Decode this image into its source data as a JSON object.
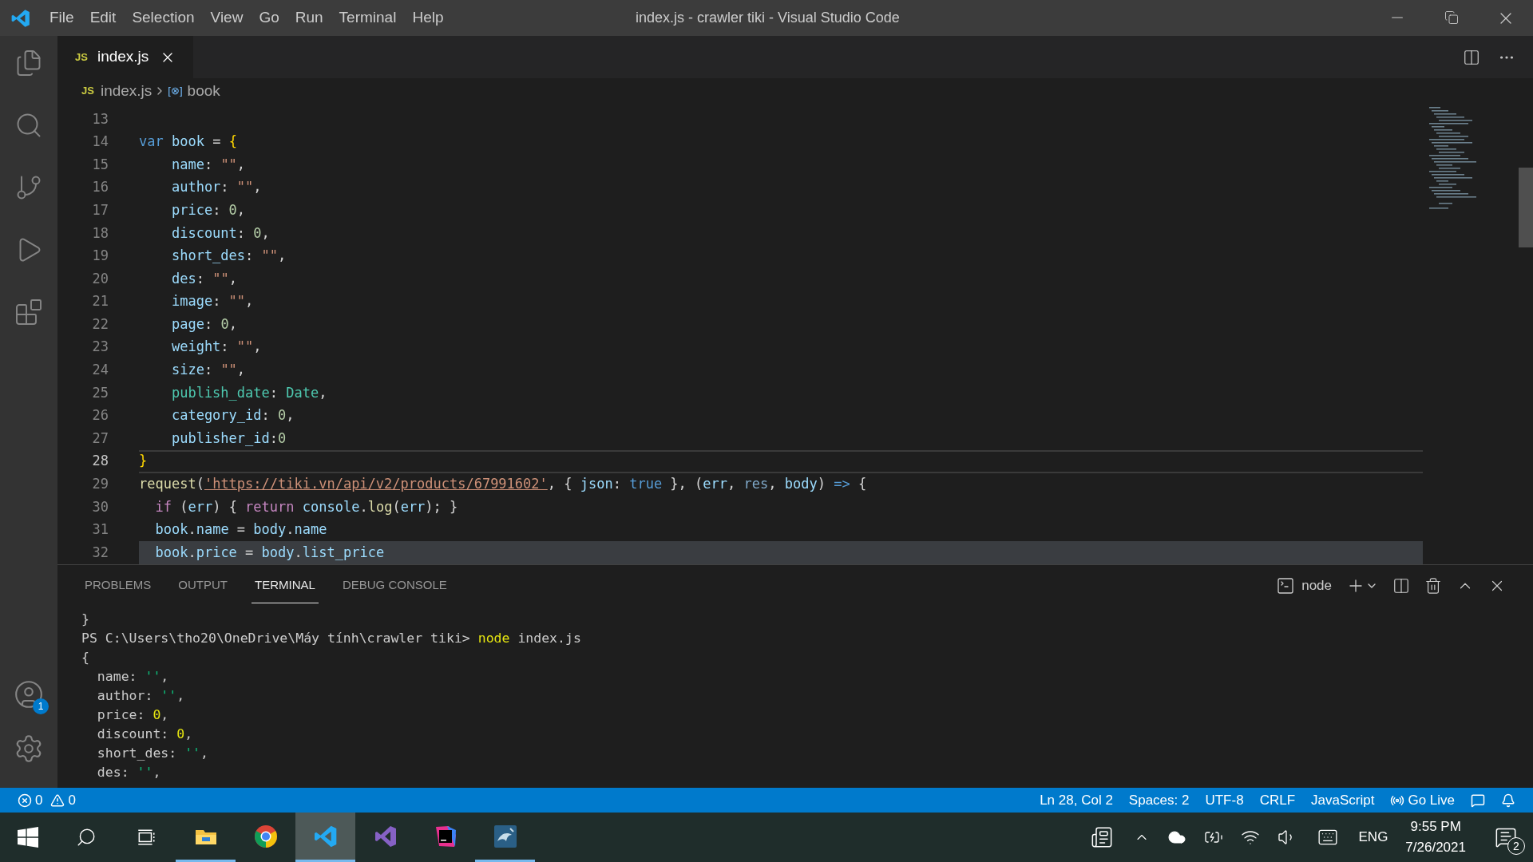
{
  "window": {
    "title": "index.js - crawler tiki - Visual Studio Code"
  },
  "menu": [
    "File",
    "Edit",
    "Selection",
    "View",
    "Go",
    "Run",
    "Terminal",
    "Help"
  ],
  "activity_bar": [
    {
      "kind": "files"
    },
    {
      "kind": "search"
    },
    {
      "kind": "source-control"
    },
    {
      "kind": "run"
    },
    {
      "kind": "extensions"
    }
  ],
  "activity_bottom": [
    {
      "kind": "account",
      "badge": "1"
    },
    {
      "kind": "settings"
    }
  ],
  "tabs": [
    {
      "icon": "JS",
      "label": "index.js",
      "selected": true
    }
  ],
  "breadcrumbs": [
    {
      "icon": "JS",
      "label": "index.js"
    },
    {
      "icon": "[⊗]",
      "label": "book"
    }
  ],
  "editor": {
    "lines": [
      {
        "number": "13",
        "current": false,
        "highlighted": false
      },
      {
        "number": "14",
        "current": false,
        "highlighted": false,
        "tokens": [
          {
            "text": "var",
            "kind": "keyword"
          },
          {
            "text": " book",
            "kind": "variable"
          },
          {
            "text": " = ",
            "kind": "punct"
          },
          {
            "text": "{",
            "kind": "bracket"
          }
        ]
      },
      {
        "number": "15",
        "current": false,
        "highlighted": false,
        "tokens": [
          {
            "text": "    name",
            "kind": "variable"
          },
          {
            "text": ": ",
            "kind": "punct"
          },
          {
            "text": "\"\"",
            "kind": "string"
          },
          {
            "text": ",",
            "kind": "punct"
          }
        ]
      },
      {
        "number": "16",
        "current": false,
        "highlighted": false,
        "tokens": [
          {
            "text": "    author",
            "kind": "variable"
          },
          {
            "text": ": ",
            "kind": "punct"
          },
          {
            "text": "\"\"",
            "kind": "string"
          },
          {
            "text": ",",
            "kind": "punct"
          }
        ]
      },
      {
        "number": "17",
        "current": false,
        "highlighted": false,
        "tokens": [
          {
            "text": "    price",
            "kind": "variable"
          },
          {
            "text": ": ",
            "kind": "punct"
          },
          {
            "text": "0",
            "kind": "number"
          },
          {
            "text": ",",
            "kind": "punct"
          }
        ]
      },
      {
        "number": "18",
        "current": false,
        "highlighted": false,
        "tokens": [
          {
            "text": "    discount",
            "kind": "variable"
          },
          {
            "text": ": ",
            "kind": "punct"
          },
          {
            "text": "0",
            "kind": "number"
          },
          {
            "text": ",",
            "kind": "punct"
          }
        ]
      },
      {
        "number": "19",
        "current": false,
        "highlighted": false,
        "tokens": [
          {
            "text": "    short_des",
            "kind": "variable"
          },
          {
            "text": ": ",
            "kind": "punct"
          },
          {
            "text": "\"\"",
            "kind": "string"
          },
          {
            "text": ",",
            "kind": "punct"
          }
        ]
      },
      {
        "number": "20",
        "current": false,
        "highlighted": false,
        "tokens": [
          {
            "text": "    des",
            "kind": "variable"
          },
          {
            "text": ": ",
            "kind": "punct"
          },
          {
            "text": "\"\"",
            "kind": "string"
          },
          {
            "text": ",",
            "kind": "punct"
          }
        ]
      },
      {
        "number": "21",
        "current": false,
        "highlighted": false,
        "tokens": [
          {
            "text": "    image",
            "kind": "variable"
          },
          {
            "text": ": ",
            "kind": "punct"
          },
          {
            "text": "\"\"",
            "kind": "string"
          },
          {
            "text": ",",
            "kind": "punct"
          }
        ]
      },
      {
        "number": "22",
        "current": false,
        "highlighted": false,
        "tokens": [
          {
            "text": "    page",
            "kind": "variable"
          },
          {
            "text": ": ",
            "kind": "punct"
          },
          {
            "text": "0",
            "kind": "number"
          },
          {
            "text": ",",
            "kind": "punct"
          }
        ]
      },
      {
        "number": "23",
        "current": false,
        "highlighted": false,
        "tokens": [
          {
            "text": "    weight",
            "kind": "variable"
          },
          {
            "text": ": ",
            "kind": "punct"
          },
          {
            "text": "\"\"",
            "kind": "string"
          },
          {
            "text": ",",
            "kind": "punct"
          }
        ]
      },
      {
        "number": "24",
        "current": false,
        "highlighted": false,
        "tokens": [
          {
            "text": "    size",
            "kind": "variable"
          },
          {
            "text": ": ",
            "kind": "punct"
          },
          {
            "text": "\"\"",
            "kind": "string"
          },
          {
            "text": ",",
            "kind": "punct"
          }
        ]
      },
      {
        "number": "25",
        "current": false,
        "highlighted": false,
        "tokens": [
          {
            "text": "    publish_date",
            "kind": "type"
          },
          {
            "text": ": ",
            "kind": "punct"
          },
          {
            "text": "Date",
            "kind": "type"
          },
          {
            "text": ",",
            "kind": "punct"
          }
        ]
      },
      {
        "number": "26",
        "current": false,
        "highlighted": false,
        "tokens": [
          {
            "text": "    category_id",
            "kind": "variable"
          },
          {
            "text": ": ",
            "kind": "punct"
          },
          {
            "text": "0",
            "kind": "number"
          },
          {
            "text": ",",
            "kind": "punct"
          }
        ]
      },
      {
        "number": "27",
        "current": false,
        "highlighted": false,
        "tokens": [
          {
            "text": "    publisher_id",
            "kind": "variable"
          },
          {
            "text": ":",
            "kind": "punct"
          },
          {
            "text": "0",
            "kind": "number"
          }
        ]
      },
      {
        "number": "28",
        "current": true,
        "highlighted": false,
        "tokens": [
          {
            "text": "}",
            "kind": "bracket"
          }
        ]
      },
      {
        "number": "29",
        "current": false,
        "highlighted": false,
        "tokens": [
          {
            "text": "request",
            "kind": "function"
          },
          {
            "text": "(",
            "kind": "punct"
          },
          {
            "text": "'https://tiki.vn/api/v2/products/67991602'",
            "kind": "link"
          },
          {
            "text": ", { ",
            "kind": "punct"
          },
          {
            "text": "json",
            "kind": "variable"
          },
          {
            "text": ": ",
            "kind": "punct"
          },
          {
            "text": "true",
            "kind": "keyword"
          },
          {
            "text": " }, (",
            "kind": "punct"
          },
          {
            "text": "err",
            "kind": "variable"
          },
          {
            "text": ", ",
            "kind": "punct"
          },
          {
            "text": "res",
            "kind": "param"
          },
          {
            "text": ", ",
            "kind": "punct"
          },
          {
            "text": "body",
            "kind": "variable"
          },
          {
            "text": ") ",
            "kind": "punct"
          },
          {
            "text": "=>",
            "kind": "keyword"
          },
          {
            "text": " {",
            "kind": "punct"
          }
        ]
      },
      {
        "number": "30",
        "current": false,
        "highlighted": false,
        "tokens": [
          {
            "text": "  if",
            "kind": "control"
          },
          {
            "text": " (",
            "kind": "punct"
          },
          {
            "text": "err",
            "kind": "variable"
          },
          {
            "text": ") { ",
            "kind": "punct"
          },
          {
            "text": "return",
            "kind": "control"
          },
          {
            "text": " console",
            "kind": "variable"
          },
          {
            "text": ".",
            "kind": "punct"
          },
          {
            "text": "log",
            "kind": "function"
          },
          {
            "text": "(",
            "kind": "punct"
          },
          {
            "text": "err",
            "kind": "variable"
          },
          {
            "text": "); }",
            "kind": "punct"
          }
        ]
      },
      {
        "number": "31",
        "current": false,
        "highlighted": false,
        "tokens": [
          {
            "text": "  book",
            "kind": "variable"
          },
          {
            "text": ".",
            "kind": "punct"
          },
          {
            "text": "name",
            "kind": "variable"
          },
          {
            "text": " = ",
            "kind": "punct"
          },
          {
            "text": "body",
            "kind": "variable"
          },
          {
            "text": ".",
            "kind": "punct"
          },
          {
            "text": "name",
            "kind": "variable"
          }
        ]
      },
      {
        "number": "32",
        "current": false,
        "highlighted": true,
        "tokens": [
          {
            "text": "  book",
            "kind": "variable"
          },
          {
            "text": ".",
            "kind": "punct"
          },
          {
            "text": "price",
            "kind": "variable"
          },
          {
            "text": " = ",
            "kind": "punct"
          },
          {
            "text": "body",
            "kind": "variable"
          },
          {
            "text": ".",
            "kind": "punct"
          },
          {
            "text": "list_price",
            "kind": "variable"
          }
        ]
      }
    ]
  },
  "panel": {
    "tabs": [
      {
        "label": "PROBLEMS",
        "selected": false
      },
      {
        "label": "OUTPUT",
        "selected": false
      },
      {
        "label": "TERMINAL",
        "selected": true
      },
      {
        "label": "DEBUG CONSOLE",
        "selected": false
      }
    ],
    "terminal_name": "node",
    "terminal_lines": [
      [
        {
          "text": "}",
          "kind": "plain"
        }
      ],
      [
        {
          "text": "PS C:\\Users\\tho20\\OneDrive\\Máy tính\\crawler tiki> ",
          "kind": "plain"
        },
        {
          "text": "node",
          "kind": "command"
        },
        {
          "text": " index.js",
          "kind": "plain"
        }
      ],
      [
        {
          "text": "{",
          "kind": "plain"
        }
      ],
      [
        {
          "text": "  name: ",
          "kind": "plain"
        },
        {
          "text": "''",
          "kind": "string"
        },
        {
          "text": ",",
          "kind": "plain"
        }
      ],
      [
        {
          "text": "  author: ",
          "kind": "plain"
        },
        {
          "text": "''",
          "kind": "string"
        },
        {
          "text": ",",
          "kind": "plain"
        }
      ],
      [
        {
          "text": "  price: ",
          "kind": "plain"
        },
        {
          "text": "0",
          "kind": "number"
        },
        {
          "text": ",",
          "kind": "plain"
        }
      ],
      [
        {
          "text": "  discount: ",
          "kind": "plain"
        },
        {
          "text": "0",
          "kind": "number"
        },
        {
          "text": ",",
          "kind": "plain"
        }
      ],
      [
        {
          "text": "  short_des: ",
          "kind": "plain"
        },
        {
          "text": "''",
          "kind": "string"
        },
        {
          "text": ",",
          "kind": "plain"
        }
      ],
      [
        {
          "text": "  des: ",
          "kind": "plain"
        },
        {
          "text": "''",
          "kind": "string"
        },
        {
          "text": ",",
          "kind": "plain"
        }
      ]
    ]
  },
  "status_bar": {
    "errors": "0",
    "warnings": "0",
    "items": [
      {
        "kind": "text",
        "label": "Ln 28, Col 2"
      },
      {
        "kind": "text",
        "label": "Spaces: 2"
      },
      {
        "kind": "text",
        "label": "UTF-8"
      },
      {
        "kind": "text",
        "label": "CRLF"
      },
      {
        "kind": "text",
        "label": "JavaScript"
      },
      {
        "kind": "live",
        "label": "Go Live"
      },
      {
        "kind": "feedback"
      },
      {
        "kind": "bell"
      }
    ]
  },
  "taskbar": {
    "apps": [
      {
        "kind": "explorer",
        "running": true,
        "selected": false
      },
      {
        "kind": "chrome",
        "running": false,
        "selected": false
      },
      {
        "kind": "vscode",
        "running": true,
        "selected": true
      },
      {
        "kind": "visualstudio",
        "running": false,
        "selected": false
      },
      {
        "kind": "intellij",
        "running": false,
        "selected": false
      },
      {
        "kind": "mysql",
        "running": true,
        "selected": false
      }
    ],
    "language": "ENG",
    "time": "9:55 PM",
    "date": "7/26/2021",
    "notifications": "2"
  }
}
